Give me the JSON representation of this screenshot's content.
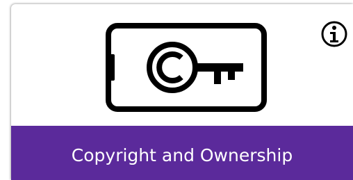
{
  "tile": {
    "label": "Copyright and Ownership",
    "illustration_icon": "copyright-key-icon",
    "info_icon": "info-icon",
    "footer_color": "#5b2a9b",
    "icon_color": "#000000"
  }
}
